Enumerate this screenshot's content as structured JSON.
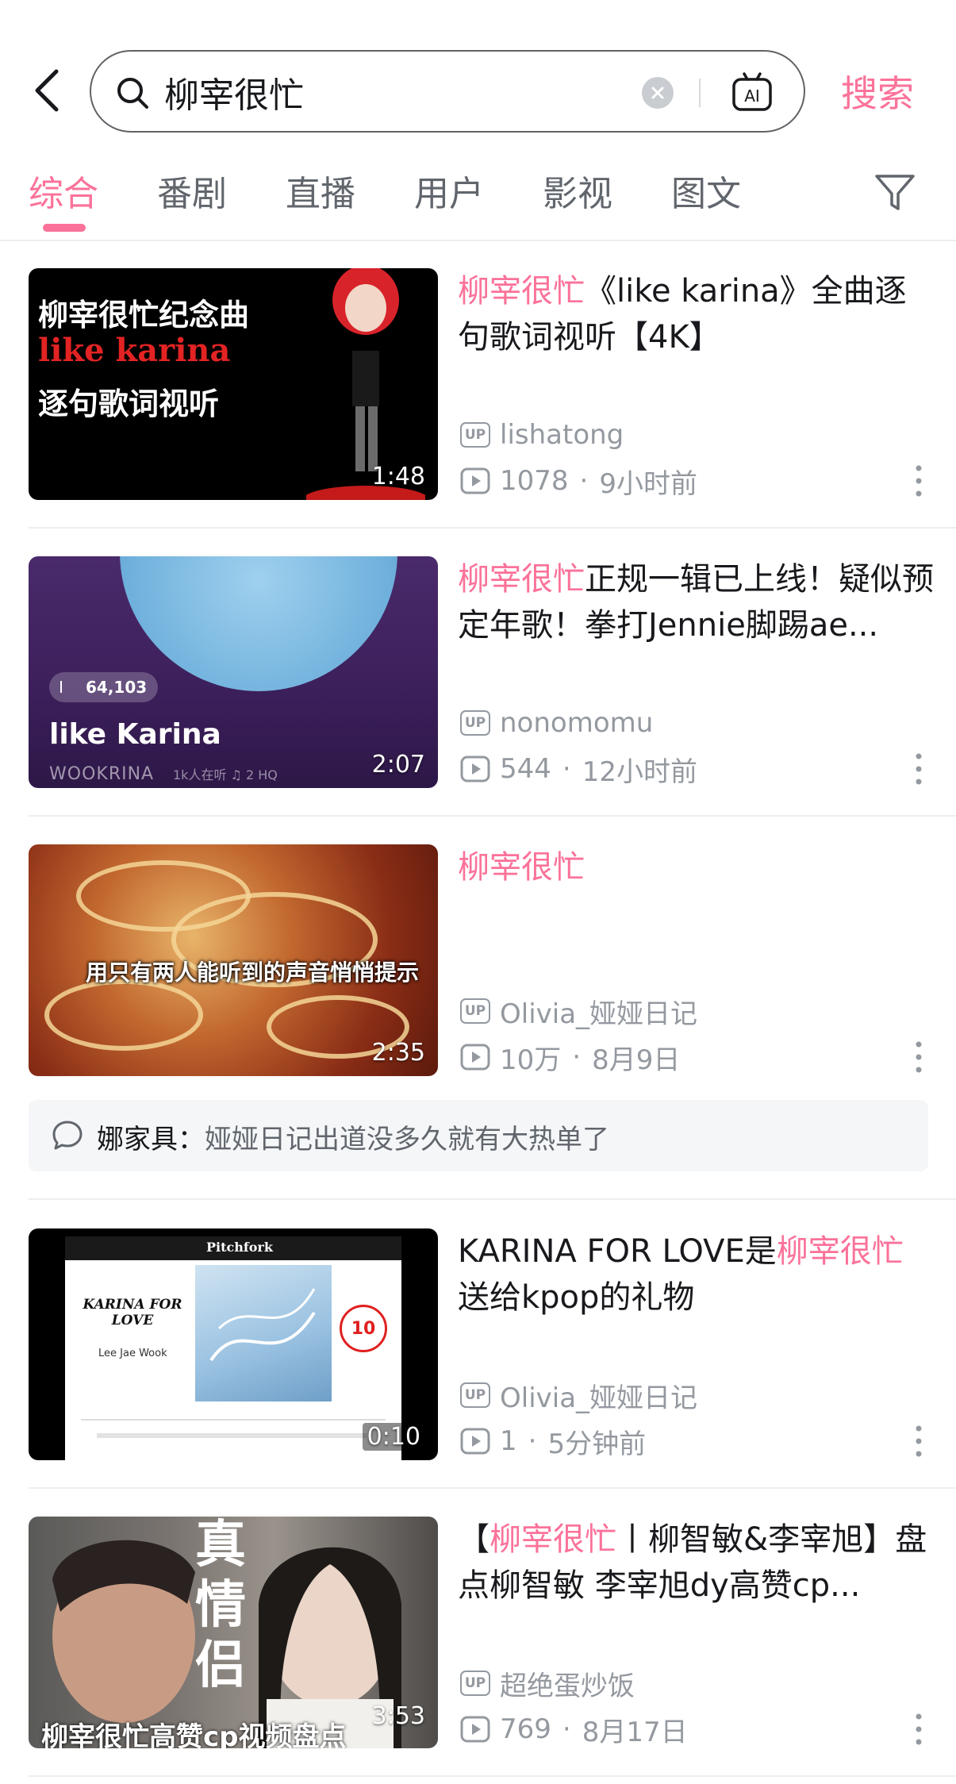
{
  "header": {
    "search_query": "柳宰很忙",
    "search_button": "搜索"
  },
  "tabs": [
    {
      "label": "综合",
      "active": true
    },
    {
      "label": "番剧",
      "active": false
    },
    {
      "label": "直播",
      "active": false
    },
    {
      "label": "用户",
      "active": false
    },
    {
      "label": "影视",
      "active": false
    },
    {
      "label": "图文",
      "active": false
    }
  ],
  "results": [
    {
      "title_highlight": "柳宰很忙",
      "title_rest": "《like karina》全曲逐句歌词视听【4K】",
      "uploader": "lishatong",
      "views": "1078",
      "time": "9小时前",
      "duration": "1:48",
      "thumb_text": [
        "柳宰很忙纪念曲",
        "like karina",
        "逐句歌词视听"
      ]
    },
    {
      "title_highlight": "柳宰很忙",
      "title_rest": "正规一辑已上线！疑似预定年歌！拳打Jennie脚踢ae...",
      "uploader": "nonomomu",
      "views": "544",
      "time": "12小时前",
      "duration": "2:07",
      "thumb_text": [
        "64,103",
        "like Karina",
        "WOOKRINA",
        "1k人在听   ♫ 2   HQ"
      ]
    },
    {
      "title_highlight": "柳宰很忙",
      "title_rest": "",
      "uploader": "Olivia_娅娅日记",
      "views": "10万",
      "time": "8月9日",
      "duration": "2:35",
      "thumb_text": [
        "用只有两人能听到的声音悄悄提示"
      ]
    },
    {
      "title_prefix": "KARINA FOR LOVE是",
      "title_highlight": "柳宰很忙",
      "title_rest": "送给kpop的礼物",
      "uploader": "Olivia_娅娅日记",
      "views": "1",
      "time": "5分钟前",
      "duration": "0:10",
      "thumb_text": [
        "Pitchfork",
        "KARINA FOR LOVE",
        "Lee Jae Wook",
        "10"
      ]
    },
    {
      "title_prefix": "【",
      "title_highlight": "柳宰很忙",
      "title_rest": "丨柳智敏&李宰旭】盘点柳智敏  李宰旭dy高赞cp...",
      "uploader": "超绝蛋炒饭",
      "views": "769",
      "time": "8月17日",
      "duration": "3:53",
      "thumb_text": [
        "真",
        "情",
        "侣",
        "柳宰很忙高赞cp视频盘点"
      ]
    }
  ],
  "comment": {
    "author": "娜家具：",
    "text": "娅娅日记出道没多久就有大热单了"
  },
  "labels": {
    "up_badge": "UP",
    "dot": "·"
  },
  "colors": {
    "accent": "#fb7299",
    "secondary_text": "#9499a0"
  }
}
